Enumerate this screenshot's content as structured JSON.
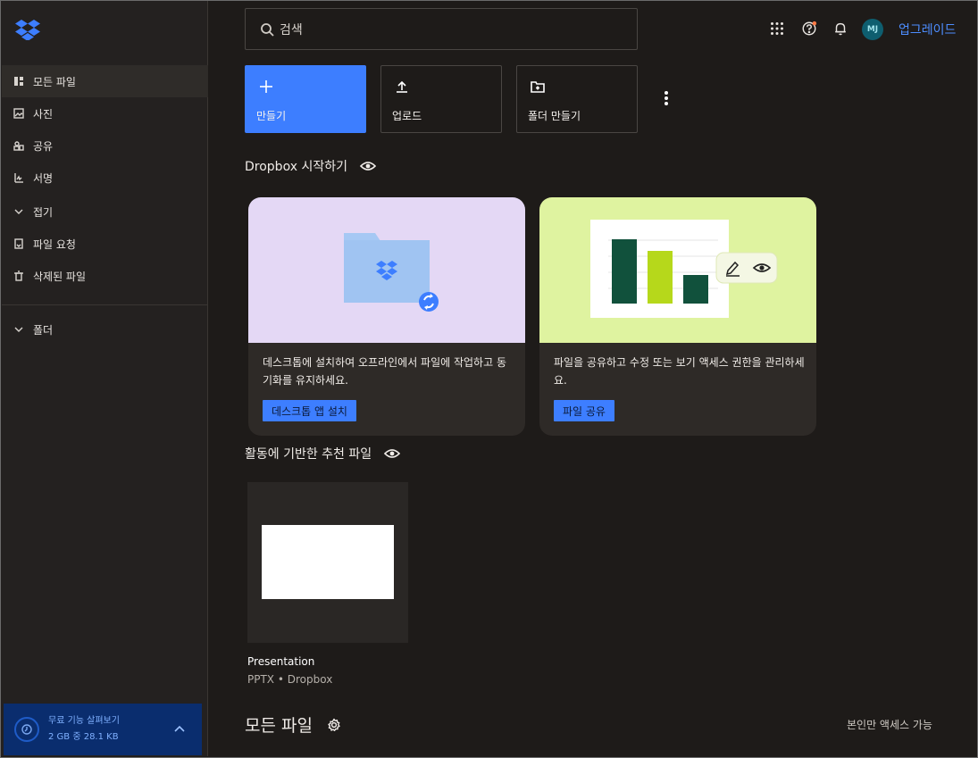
{
  "sidebar": {
    "items": [
      {
        "label": "모든 파일",
        "icon": "files-icon"
      },
      {
        "label": "사진",
        "icon": "photo-icon"
      },
      {
        "label": "공유",
        "icon": "shared-icon"
      },
      {
        "label": "서명",
        "icon": "signature-icon"
      },
      {
        "label": "접기",
        "icon": "chevron-down-icon"
      },
      {
        "label": "파일 요청",
        "icon": "file-request-icon"
      },
      {
        "label": "삭제된 파일",
        "icon": "trash-icon"
      }
    ],
    "folders_label": "폴더",
    "trial": {
      "title": "무료 기능 살펴보기",
      "usage": "2 GB 중 28.1 KB"
    }
  },
  "header": {
    "search_placeholder": "검색",
    "avatar_initials": "MJ",
    "upgrade_label": "업그레이드"
  },
  "actions": [
    {
      "label": "만들기",
      "icon": "plus-icon"
    },
    {
      "label": "업로드",
      "icon": "upload-icon"
    },
    {
      "label": "폴더 만들기",
      "icon": "folder-plus-icon"
    }
  ],
  "getting_started": {
    "title": "Dropbox 시작하기",
    "cards": [
      {
        "description": "데스크톱에 설치하여 오프라인에서 파일에 작업하고 동기화를 유지하세요.",
        "button": "데스크톱 앱 설치"
      },
      {
        "description": "파일을 공유하고 수정 또는 보기 액세스 권한을 관리하세요.",
        "button": "파일 공유"
      }
    ]
  },
  "recommended": {
    "title": "활동에 기반한 추천 파일",
    "files": [
      {
        "name": "Presentation",
        "meta": "PPTX • Dropbox"
      }
    ]
  },
  "all_files": {
    "title": "모든 파일",
    "access_label": "본인만 액세스 가능"
  },
  "colors": {
    "accent": "#3d7eff",
    "background": "#1e1b19",
    "card_purple": "#e4d8f5",
    "card_green": "#dff3a0"
  }
}
